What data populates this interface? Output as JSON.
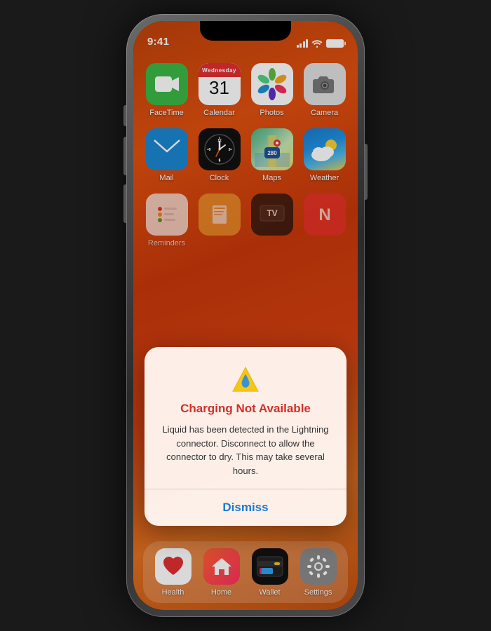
{
  "phone": {
    "status": {
      "time": "9:41"
    }
  },
  "apps": {
    "row1": [
      {
        "id": "facetime",
        "label": "FaceTime"
      },
      {
        "id": "calendar",
        "label": "Calendar"
      },
      {
        "id": "photos",
        "label": "Photos"
      },
      {
        "id": "camera",
        "label": "Camera"
      }
    ],
    "row2": [
      {
        "id": "mail",
        "label": "Mail"
      },
      {
        "id": "clock",
        "label": "Clock"
      },
      {
        "id": "maps",
        "label": "Maps"
      },
      {
        "id": "weather",
        "label": "Weather"
      }
    ],
    "row3": [
      {
        "id": "reminders",
        "label": "Reminders"
      },
      {
        "id": "books",
        "label": "Books"
      },
      {
        "id": "tv",
        "label": "TV"
      },
      {
        "id": "news",
        "label": "News"
      }
    ],
    "dock": [
      {
        "id": "health",
        "label": "Health"
      },
      {
        "id": "home",
        "label": "Home"
      },
      {
        "id": "wallet",
        "label": "Wallet"
      },
      {
        "id": "settings",
        "label": "Settings"
      }
    ]
  },
  "calendar": {
    "weekday": "Wednesday",
    "day": "31"
  },
  "alert": {
    "title": "Charging Not Available",
    "message": "Liquid has been detected in the Lightning connector. Disconnect to allow the connector to dry. This may take several hours.",
    "dismiss_label": "Dismiss"
  }
}
